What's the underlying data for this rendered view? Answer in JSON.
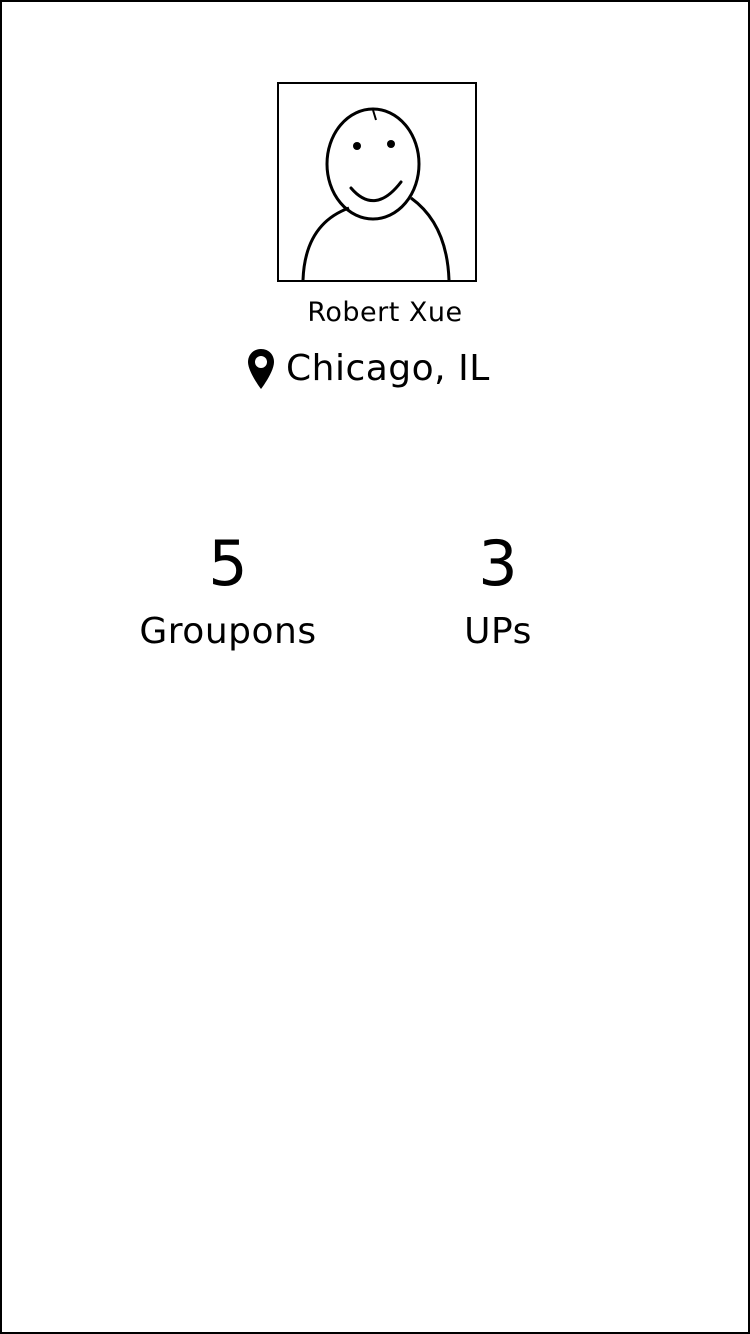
{
  "profile": {
    "name": "Robert Xue",
    "location": "Chicago, IL",
    "avatar_icon": "smiley-person-avatar-icon",
    "location_icon": "map-pin-icon"
  },
  "stats": [
    {
      "value": "5",
      "label": "Groupons"
    },
    {
      "value": "3",
      "label": "UPs"
    }
  ]
}
